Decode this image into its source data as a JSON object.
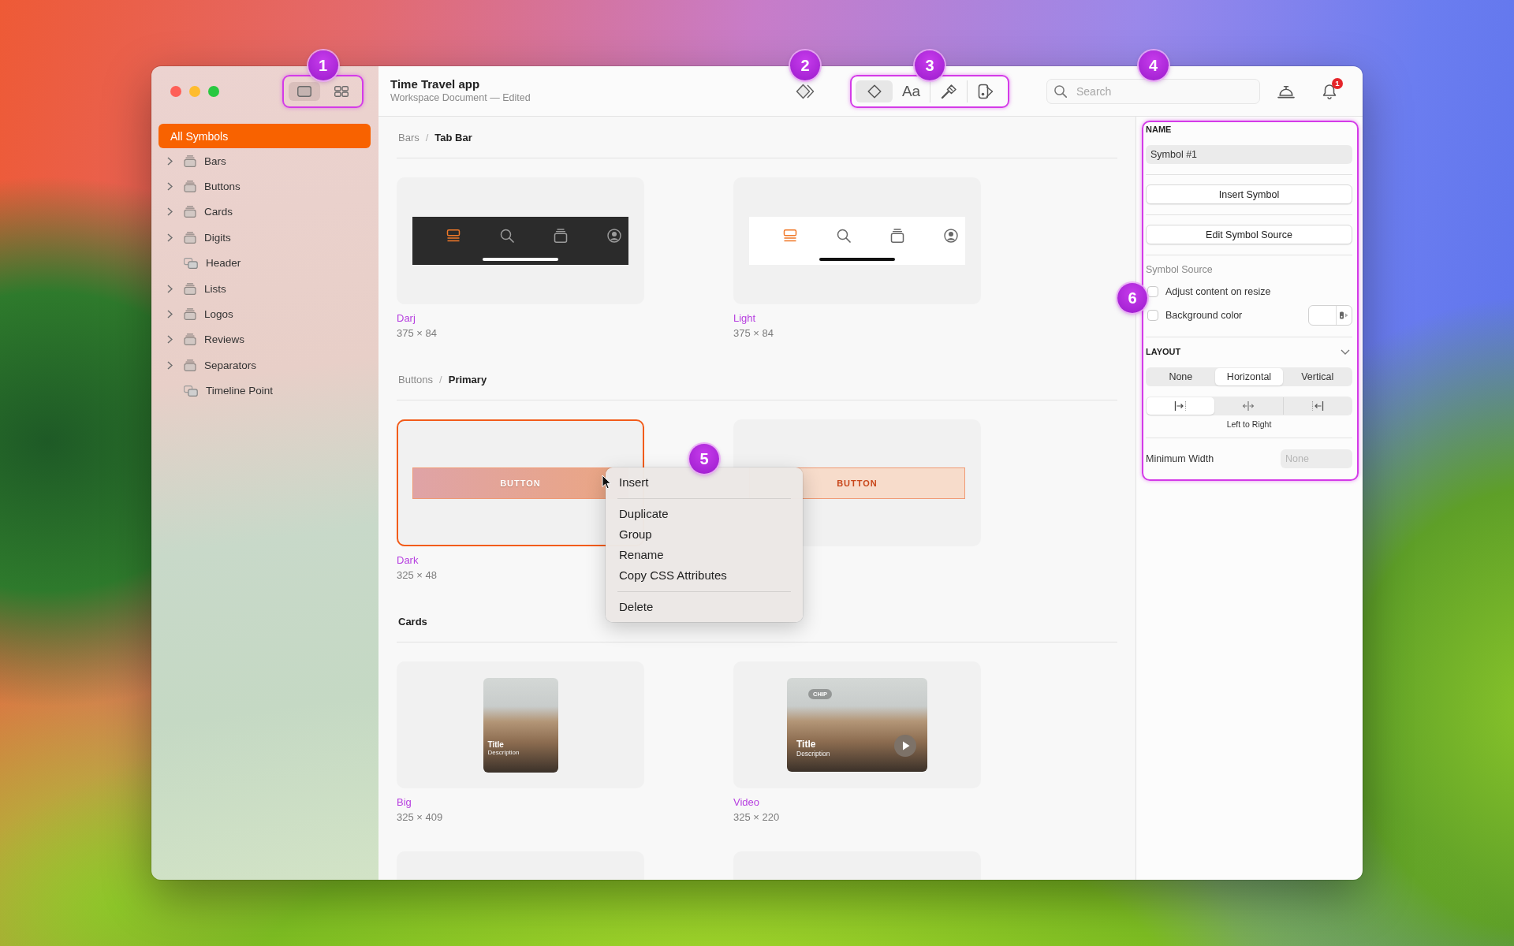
{
  "window": {
    "title": "Time Travel app",
    "subtitle": "Workspace Document — Edited"
  },
  "view_toggle": {
    "highlighted": true,
    "callout": "1",
    "options": [
      {
        "selected": true
      },
      {
        "selected": false
      }
    ]
  },
  "sidebar": {
    "items": [
      {
        "kind": "all",
        "label": "All Symbols",
        "selected": true
      },
      {
        "kind": "group",
        "label": "Bars",
        "selected": false,
        "expanded": false
      },
      {
        "kind": "group",
        "label": "Buttons",
        "selected": false,
        "expanded": false
      },
      {
        "kind": "group",
        "label": "Cards",
        "selected": false,
        "expanded": false
      },
      {
        "kind": "group",
        "label": "Digits",
        "selected": false,
        "expanded": false
      },
      {
        "kind": "symbol",
        "label": "Header",
        "selected": false
      },
      {
        "kind": "group",
        "label": "Lists",
        "selected": false,
        "expanded": false
      },
      {
        "kind": "group",
        "label": "Logos",
        "selected": false,
        "expanded": false
      },
      {
        "kind": "group",
        "label": "Reviews",
        "selected": false,
        "expanded": false
      },
      {
        "kind": "group",
        "label": "Separators",
        "selected": false,
        "expanded": false
      },
      {
        "kind": "symbol",
        "label": "Timeline Point",
        "selected": false
      }
    ]
  },
  "toolbar": {
    "symbols_button": {
      "callout": "2"
    },
    "tools": {
      "highlighted": true,
      "callout": "3",
      "items": [
        {
          "kind": "icon",
          "selected": true
        },
        {
          "kind": "text",
          "label": "Aa",
          "selected": false
        },
        {
          "kind": "icon",
          "selected": false
        },
        {
          "kind": "icon",
          "selected": false
        }
      ]
    },
    "search": {
      "placeholder": "Search",
      "callout": "4"
    },
    "notifications": {
      "badge": "1"
    }
  },
  "sections": [
    {
      "breadcrumb": {
        "parent": "Bars",
        "separator": "/",
        "current": "Tab Bar"
      },
      "cards": [
        {
          "kind": "tab_bar",
          "dark": true,
          "name": "Darj",
          "size": "375 × 84",
          "selected": false
        },
        {
          "kind": "tab_bar",
          "dark": false,
          "name": "Light",
          "size": "375 × 84",
          "selected": false
        }
      ]
    },
    {
      "breadcrumb": {
        "parent": "Buttons",
        "separator": "/",
        "current": "Primary"
      },
      "cards": [
        {
          "kind": "button",
          "dark": true,
          "label": "BUTTON",
          "name": "Dark",
          "size": "325 × 48",
          "selected": true,
          "context_menu": {
            "callout": "5",
            "groups": [
              [
                "Insert"
              ],
              [
                "Duplicate",
                "Group",
                "Rename",
                "Copy CSS Attributes"
              ],
              [
                "Delete"
              ]
            ]
          }
        },
        {
          "kind": "button",
          "dark": false,
          "label": "BUTTON",
          "selected": false
        }
      ]
    },
    {
      "breadcrumb": {
        "current": "Cards"
      },
      "cards": [
        {
          "kind": "photo",
          "title": "Title",
          "description": "Description",
          "name": "Big",
          "size": "325 × 409",
          "selected": false
        },
        {
          "kind": "video",
          "chip": "CHIP",
          "title": "Title",
          "description": "Description",
          "name": "Video",
          "size": "325 × 220",
          "selected": false
        },
        {
          "kind": "empty",
          "selected": false
        },
        {
          "kind": "empty",
          "selected": false
        }
      ]
    }
  ],
  "inspector": {
    "highlighted": true,
    "callout": "6",
    "name_label": "NAME",
    "name_value": "Symbol #1",
    "buttons": [
      "Insert Symbol",
      "Edit Symbol Source"
    ],
    "source": {
      "heading": "Symbol Source",
      "options": [
        {
          "kind": "checkbox",
          "label": "Adjust content on resize",
          "checked": false
        },
        {
          "kind": "color",
          "label": "Background color",
          "checked": false
        }
      ]
    },
    "layout": {
      "heading": "LAYOUT",
      "expanded": true,
      "modes": [
        {
          "label": "None",
          "selected": false
        },
        {
          "label": "Horizontal",
          "selected": true
        },
        {
          "label": "Vertical",
          "selected": false
        }
      ],
      "directions": [
        {
          "selected": true
        },
        {
          "selected": false
        },
        {
          "selected": false
        }
      ],
      "direction_caption": "Left to Right",
      "min_width": {
        "label": "Minimum Width",
        "placeholder": "None"
      }
    }
  }
}
